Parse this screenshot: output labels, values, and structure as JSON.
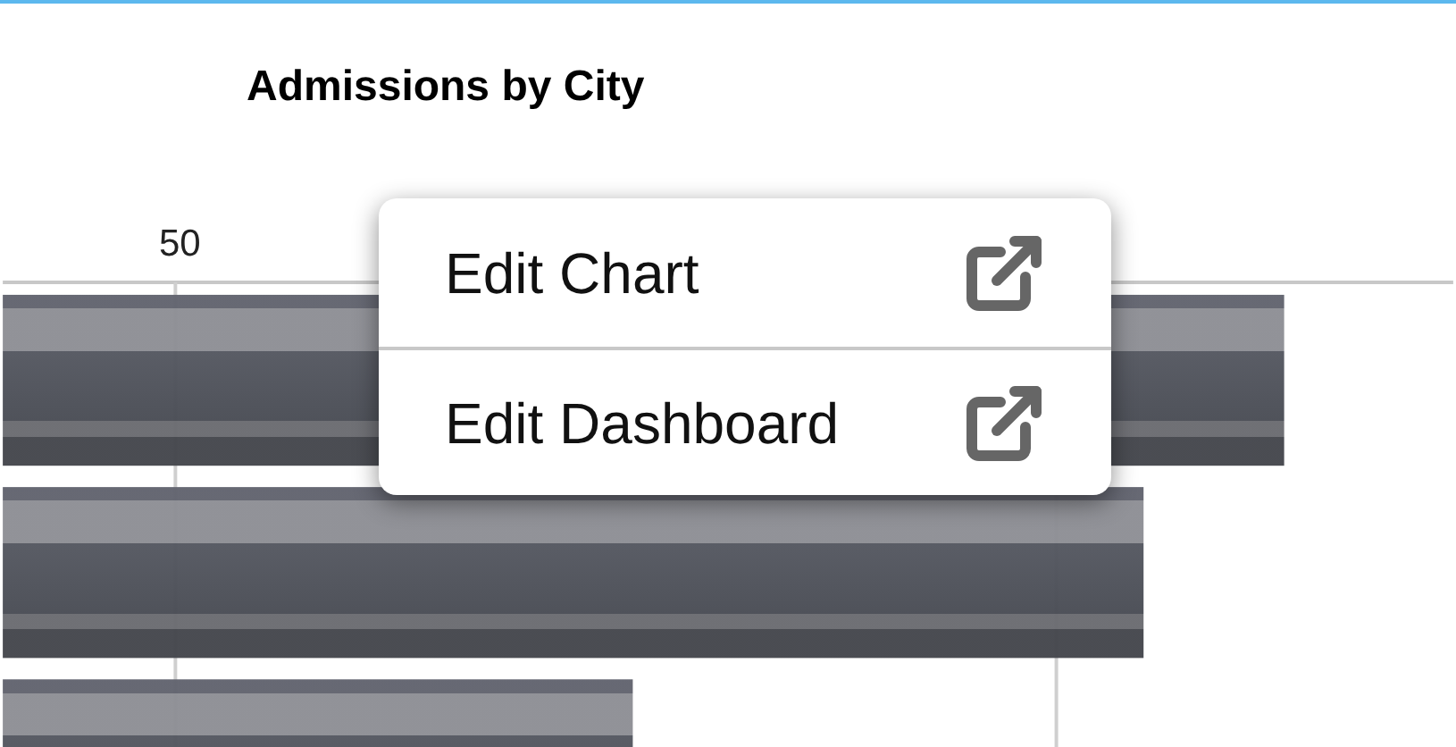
{
  "chart": {
    "title": "Admissions by City",
    "tick_label": "50"
  },
  "context_menu": {
    "items": [
      {
        "label": "Edit Chart"
      },
      {
        "label": "Edit Dashboard"
      }
    ]
  }
}
